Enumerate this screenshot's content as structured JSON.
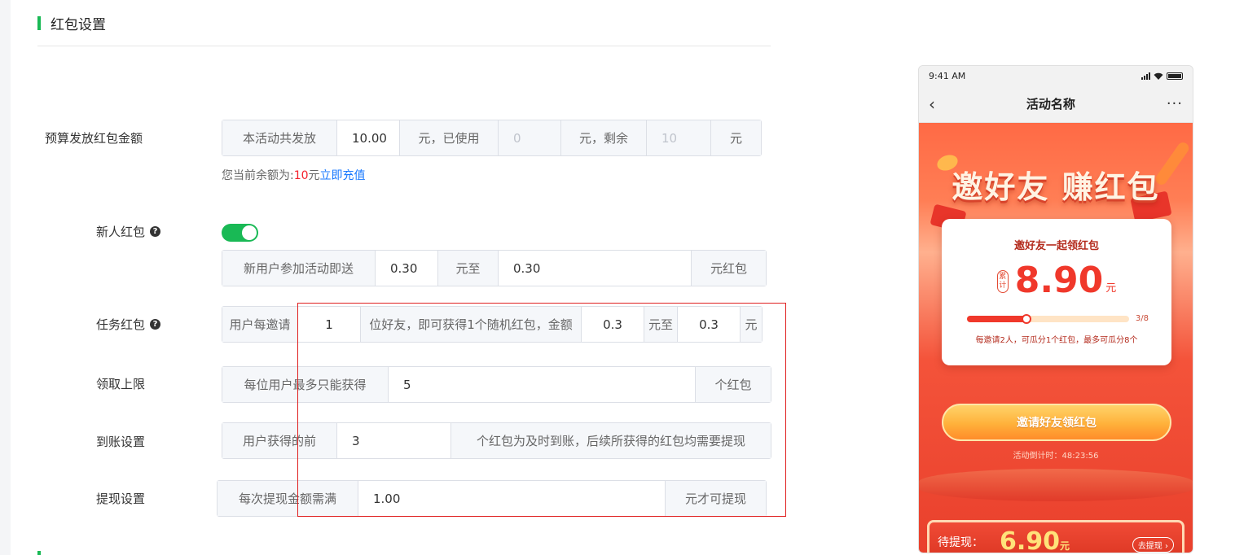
{
  "section": {
    "title": "红包设置"
  },
  "budget": {
    "label": "预算发放红包金额",
    "prefix": "本活动共发放",
    "total": "10.00",
    "used_label": "元，已使用",
    "used": "0",
    "remain_label": "元，剩余",
    "remain": "10",
    "unit": "元",
    "hint_prefix": "您当前余额为:",
    "balance": "10",
    "hint_unit": "元",
    "recharge_link": "立即充值"
  },
  "newcomer": {
    "label": "新人红包",
    "help": "?",
    "enabled": true,
    "prefix": "新用户参加活动即送",
    "min": "0.30",
    "to_label": "元至",
    "max": "0.30",
    "suffix": "元红包"
  },
  "task": {
    "label": "任务红包",
    "help": "?",
    "prefix": "用户每邀请",
    "count": "1",
    "mid": "位好友，即可获得1个随机红包，金额",
    "min": "0.3",
    "to_label": "元至",
    "max": "0.3",
    "unit": "元"
  },
  "limit": {
    "label": "领取上限",
    "prefix": "每位用户最多只能获得",
    "value": "5",
    "suffix": "个红包"
  },
  "arrival": {
    "label": "到账设置",
    "prefix": "用户获得的前",
    "value": "3",
    "suffix": "个红包为及时到账，后续所获得的红包均需要提现"
  },
  "withdraw": {
    "label": "提现设置",
    "prefix": "每次提现金额需满",
    "value": "1.00",
    "suffix": "元才可提现"
  },
  "phone": {
    "time": "9:41 AM",
    "nav_title": "活动名称",
    "back": "‹",
    "more": "···",
    "banner": "邀好友 赚红包",
    "card_title": "邀好友一起领红包",
    "tag": "累计",
    "amount": "8.90",
    "amount_unit": "元",
    "progress": 0.375,
    "progress_text": "3/8",
    "note": "每邀请2人，可瓜分1个红包，最多可瓜分8个",
    "cta": "邀请好友领红包",
    "countdown": "活动倒计时：48:23:56",
    "pending_label": "待提现：",
    "pending_amount": "6.90",
    "pending_unit": "元",
    "withdraw_btn": "去提现 ›"
  }
}
